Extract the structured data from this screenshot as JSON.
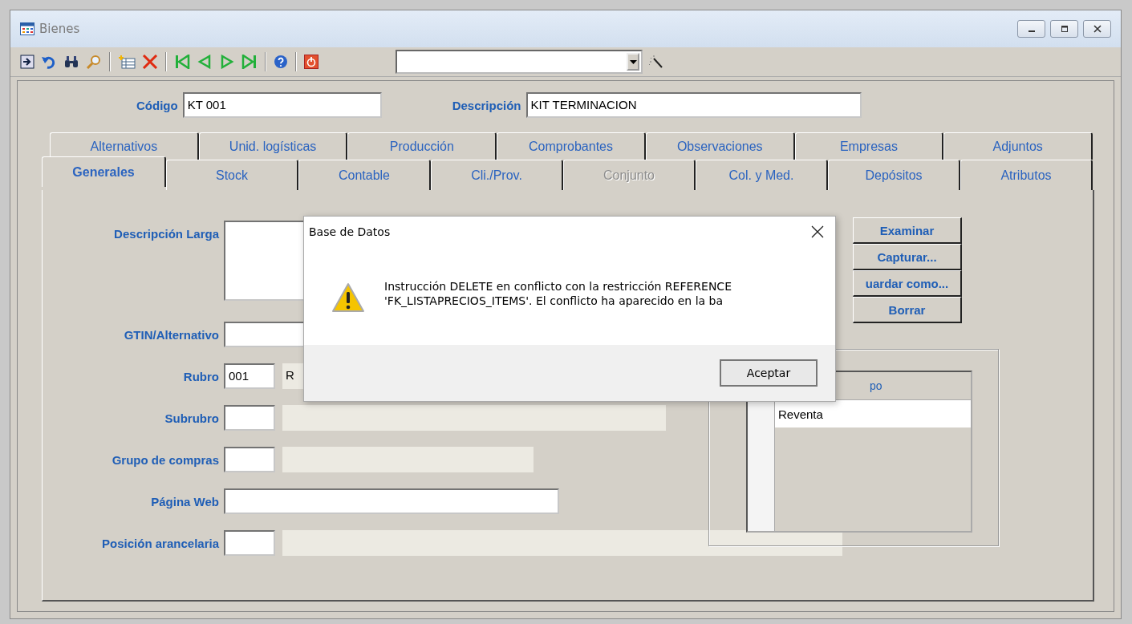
{
  "window": {
    "title": "Bienes"
  },
  "header_fields": [
    {
      "label": "Código",
      "value": "KT 001",
      "kind": "short"
    },
    {
      "label": "Descripción",
      "value": "KIT TERMINACION",
      "kind": "long"
    }
  ],
  "tab_rows": [
    [
      {
        "label": "Alternativos",
        "selected": false,
        "disabled": false
      },
      {
        "label": "Unid. logísticas",
        "selected": false,
        "disabled": false
      },
      {
        "label": "Producción",
        "selected": false,
        "disabled": false
      },
      {
        "label": "Comprobantes",
        "selected": false,
        "disabled": false
      },
      {
        "label": "Observaciones",
        "selected": false,
        "disabled": false
      },
      {
        "label": "Empresas",
        "selected": false,
        "disabled": false
      },
      {
        "label": "Adjuntos",
        "selected": false,
        "disabled": false
      }
    ],
    [
      {
        "label": "Generales",
        "selected": true,
        "disabled": false
      },
      {
        "label": "Stock",
        "selected": false,
        "disabled": false
      },
      {
        "label": "Contable",
        "selected": false,
        "disabled": false
      },
      {
        "label": "Cli./Prov.",
        "selected": false,
        "disabled": false
      },
      {
        "label": "Conjunto",
        "selected": false,
        "disabled": true
      },
      {
        "label": "Col. y Med.",
        "selected": false,
        "disabled": false
      },
      {
        "label": "Depósitos",
        "selected": false,
        "disabled": false
      },
      {
        "label": "Atributos",
        "selected": false,
        "disabled": false
      }
    ]
  ],
  "form": [
    {
      "label": "Descripción Larga",
      "kind": "textarea"
    },
    {
      "label": "GTIN/Alternativo",
      "kind": "text"
    },
    {
      "label": "Rubro",
      "kind": "code",
      "code": "001",
      "description": "R"
    },
    {
      "label": "Subrubro",
      "kind": "code"
    },
    {
      "label": "Grupo de compras",
      "kind": "code"
    },
    {
      "label": "Página Web",
      "kind": "text"
    },
    {
      "label": "Posición arancelaria",
      "kind": "code"
    }
  ],
  "image_buttons": [
    "Examinar",
    "Capturar...",
    "uardar como...",
    "Borrar"
  ],
  "grid": {
    "columns": [
      "po"
    ],
    "rows": [
      {
        "cells": [
          "Reventa"
        ],
        "selected": true
      }
    ]
  },
  "dialog": {
    "title": "Base de Datos",
    "message": "Instrucción DELETE en conflicto con la restricción REFERENCE\n'FK_LISTAPRECIOS_ITEMS'. El conflicto ha aparecido en la ba",
    "buttons": [
      "Aceptar"
    ]
  }
}
